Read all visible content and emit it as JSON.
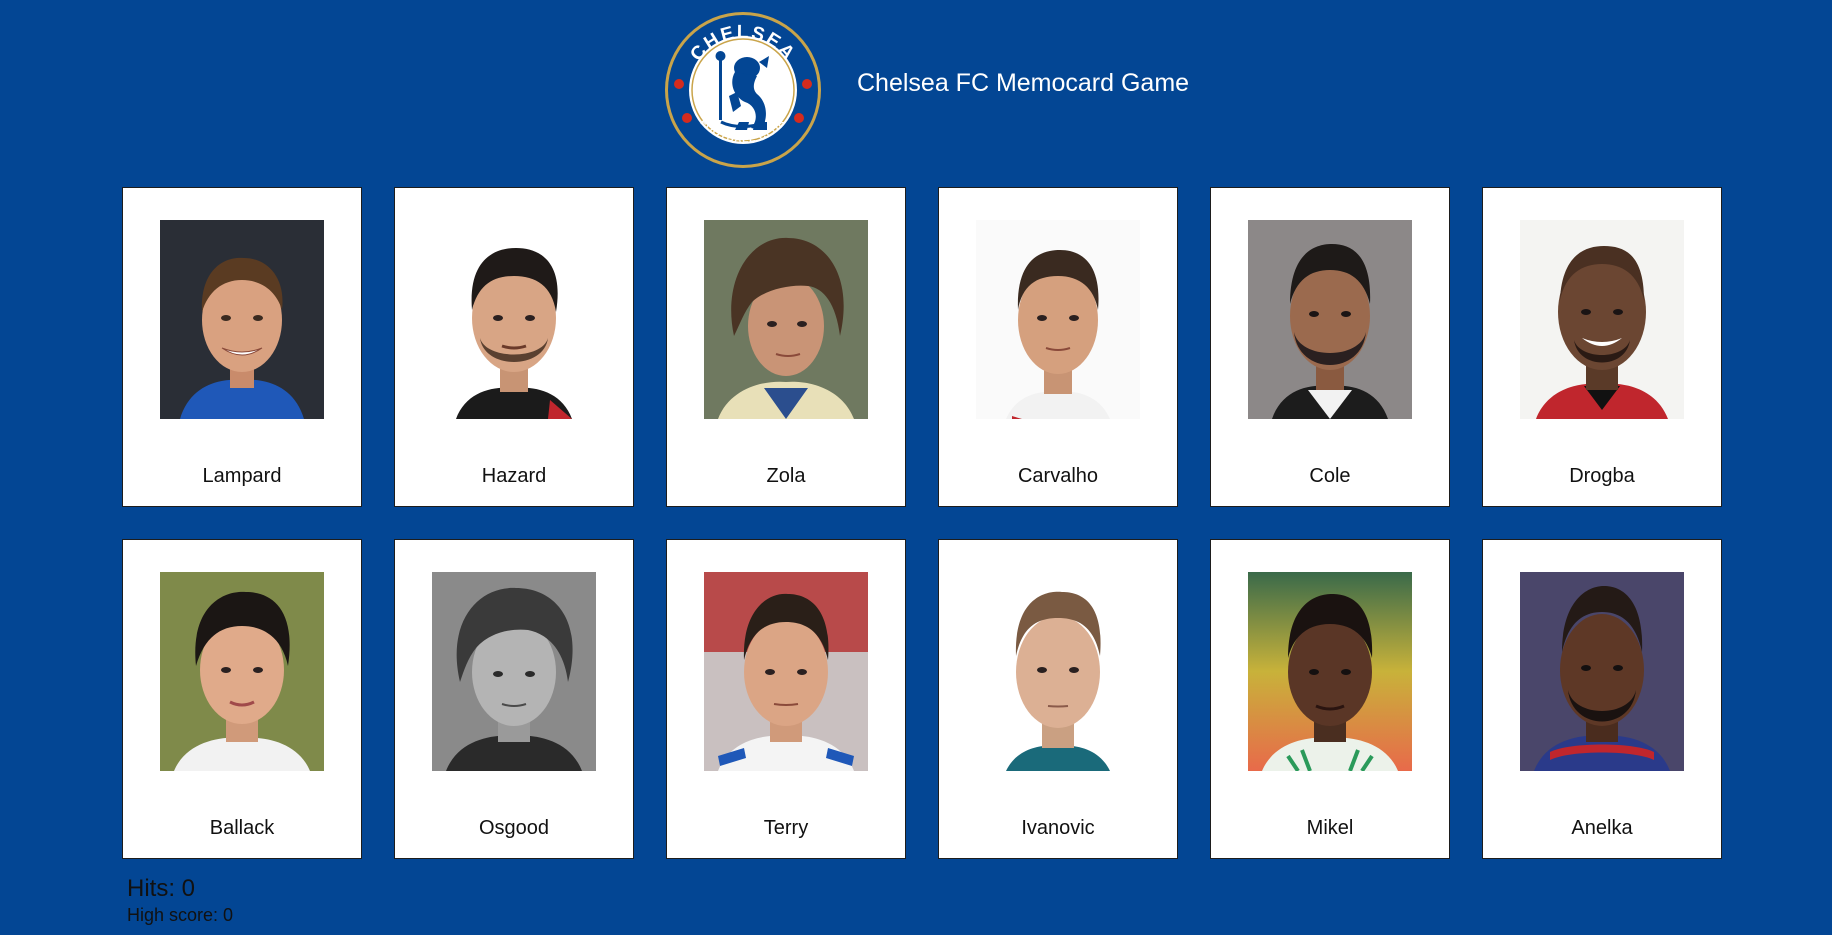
{
  "header": {
    "logo_text_top": "CHELSEA",
    "logo_text_bottom": "FOOTBALL CLUB",
    "title": "Chelsea FC Memocard Game"
  },
  "colors": {
    "background": "#034694",
    "card": "#ffffff",
    "logo_gold": "#c9a44a",
    "logo_blue": "#034694",
    "logo_red": "#d52b1e"
  },
  "cards": [
    {
      "name": "Lampard",
      "icon": "player-photo-lampard"
    },
    {
      "name": "Hazard",
      "icon": "player-photo-hazard"
    },
    {
      "name": "Zola",
      "icon": "player-photo-zola"
    },
    {
      "name": "Carvalho",
      "icon": "player-photo-carvalho"
    },
    {
      "name": "Cole",
      "icon": "player-photo-cole"
    },
    {
      "name": "Drogba",
      "icon": "player-photo-drogba"
    },
    {
      "name": "Ballack",
      "icon": "player-photo-ballack"
    },
    {
      "name": "Osgood",
      "icon": "player-photo-osgood"
    },
    {
      "name": "Terry",
      "icon": "player-photo-terry"
    },
    {
      "name": "Ivanovic",
      "icon": "player-photo-ivanovic"
    },
    {
      "name": "Mikel",
      "icon": "player-photo-mikel"
    },
    {
      "name": "Anelka",
      "icon": "player-photo-anelka"
    }
  ],
  "score": {
    "hits_label": "Hits: 0",
    "high_score_label": "High score: 0"
  }
}
